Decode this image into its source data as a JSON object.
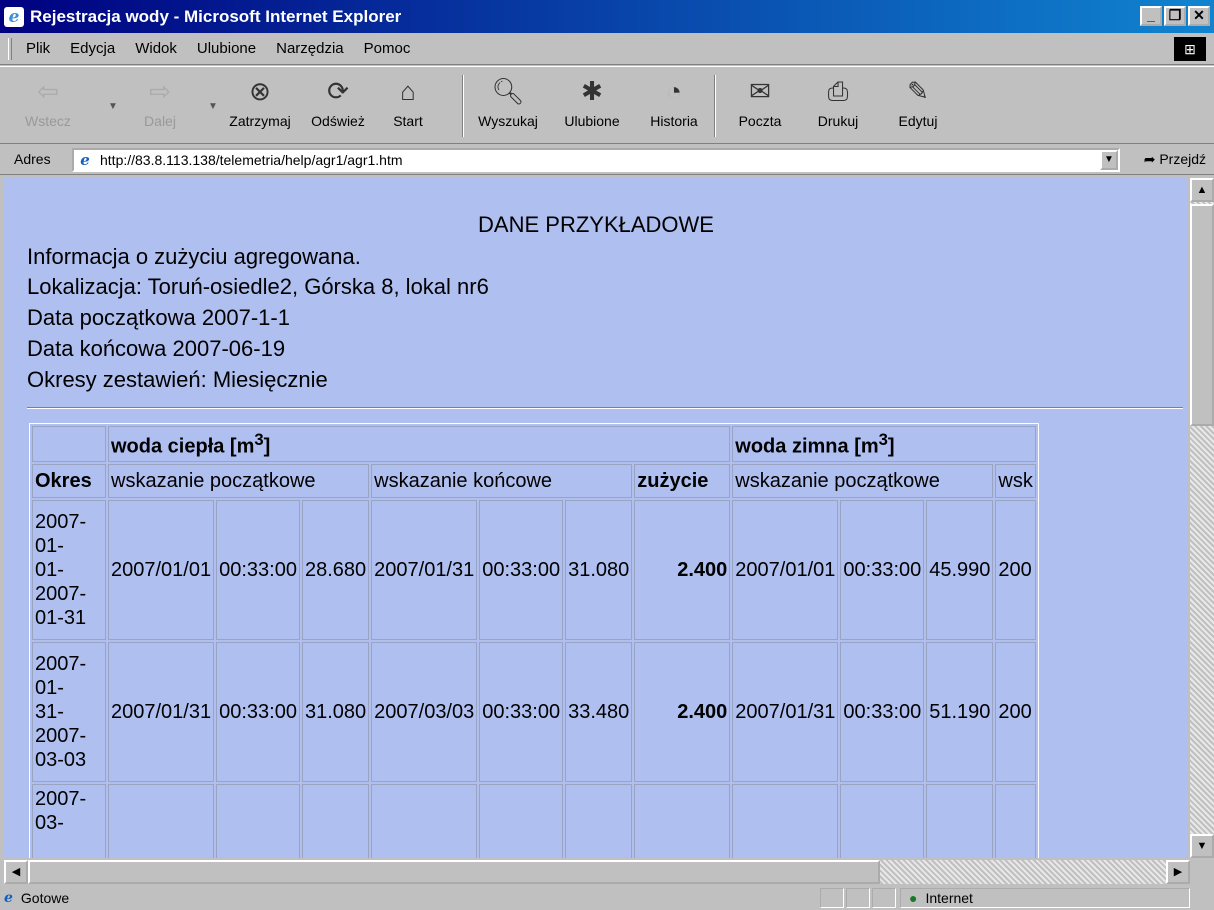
{
  "window": {
    "title": "Rejestracja wody - Microsoft Internet Explorer"
  },
  "menu": [
    "Plik",
    "Edycja",
    "Widok",
    "Ulubione",
    "Narzędzia",
    "Pomoc"
  ],
  "toolbar": {
    "back": "Wstecz",
    "forward": "Dalej",
    "stop": "Zatrzymaj",
    "refresh": "Odśwież",
    "home": "Start",
    "search": "Wyszukaj",
    "favorites": "Ulubione",
    "history": "Historia",
    "mail": "Poczta",
    "print": "Drukuj",
    "edit": "Edytuj"
  },
  "address": {
    "label": "Adres",
    "url": "http://83.8.113.138/telemetria/help/agr1/agr1.htm",
    "go": "Przejdź"
  },
  "page": {
    "heading": "DANE PRZYKŁADOWE",
    "info1": "Informacja o zużyciu agregowana.",
    "info2": "Lokalizacja: Toruń-osiedle2, Górska 8, lokal nr6",
    "info3": "Data początkowa 2007-1-1",
    "info4": "Data końcowa 2007-06-19",
    "info5": "Okresy zestawień: Miesięcznie"
  },
  "table": {
    "group_hot": "woda ciepła [m",
    "group_cold": "woda zimna [m",
    "sup": "3",
    "close": "]",
    "col_okres": "Okres",
    "col_start": "wskazanie początkowe",
    "col_end": "wskazanie końcowe",
    "col_use": "zużycie",
    "col_start2": "wskazanie początkowe",
    "col_cut": "wsk",
    "rows": [
      {
        "okres": [
          "2007-",
          "01-",
          "01-",
          "2007-",
          "01-31"
        ],
        "d1": "2007/01/01",
        "t1": "00:33:00",
        "v1": "28.680",
        "d2": "2007/01/31",
        "t2": "00:33:00",
        "v2": "31.080",
        "use": "2.400",
        "d3": "2007/01/01",
        "t3": "00:33:00",
        "v3": "45.990",
        "cut": "200"
      },
      {
        "okres": [
          "2007-",
          "01-",
          "31-",
          "2007-",
          "03-03"
        ],
        "d1": "2007/01/31",
        "t1": "00:33:00",
        "v1": "31.080",
        "d2": "2007/03/03",
        "t2": "00:33:00",
        "v2": "33.480",
        "use": "2.400",
        "d3": "2007/01/31",
        "t3": "00:33:00",
        "v3": "51.190",
        "cut": "200"
      },
      {
        "okres": [
          "2007-",
          "03-"
        ]
      }
    ]
  },
  "status": {
    "text": "Gotowe",
    "zone": "Internet"
  }
}
